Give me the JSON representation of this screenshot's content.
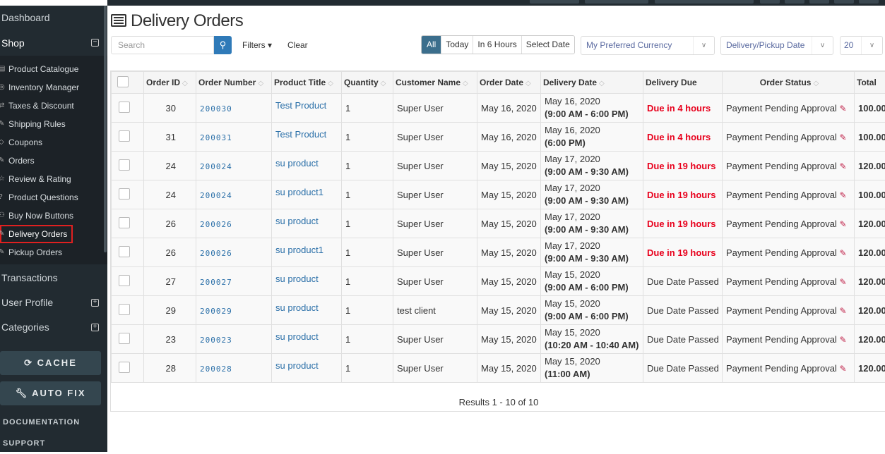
{
  "sidebar": {
    "dashboard": "Dashboard",
    "shop": "Shop",
    "items": [
      {
        "label": "Product Catalogue",
        "icon": "catalogue-icon"
      },
      {
        "label": "Inventory Manager",
        "icon": "inventory-icon"
      },
      {
        "label": "Taxes & Discount",
        "icon": "exchange-icon"
      },
      {
        "label": "Shipping Rules",
        "icon": "wrench-icon"
      },
      {
        "label": "Coupons",
        "icon": "tag-icon"
      },
      {
        "label": "Orders",
        "icon": "pencil-icon"
      },
      {
        "label": "Review & Rating",
        "icon": "star-icon"
      },
      {
        "label": "Product Questions",
        "icon": "question-icon"
      },
      {
        "label": "Buy Now Buttons",
        "icon": "cart-icon"
      },
      {
        "label": "Delivery Orders",
        "icon": "pencil-icon",
        "active": true
      },
      {
        "label": "Pickup Orders",
        "icon": "pencil-icon"
      }
    ],
    "transactions": "Transactions",
    "user_profile": "User Profile",
    "categories": "Categories",
    "cache": "CACHE",
    "auto_fix": "AUTO FIX",
    "documentation": "DOCUMENTATION",
    "support": "SUPPORT"
  },
  "page": {
    "title": "Delivery Orders"
  },
  "toolbar": {
    "search_placeholder": "Search",
    "filters": "Filters ▾",
    "clear": "Clear",
    "segments": [
      "All",
      "Today",
      "In 6 Hours",
      "Select Date"
    ],
    "active_segment": "All",
    "currency": "My Preferred Currency",
    "date_type": "Delivery/Pickup Date",
    "page_size": "20"
  },
  "table": {
    "headers": [
      "Order ID",
      "Order Number",
      "Product Title",
      "Quantity",
      "Customer Name",
      "Order Date",
      "Delivery Date",
      "Delivery Due",
      "Order Status",
      "Total"
    ],
    "rows": [
      {
        "id": "30",
        "num": "200030",
        "product": "Test Product",
        "qty": "1",
        "customer": "Super User",
        "order_date": "May 16, 2020",
        "delivery_date": "May 16, 2020",
        "delivery_time": "(9:00 AM - 6:00 PM)",
        "due": "Due in 4 hours",
        "overdue": false,
        "status": "Payment Pending Approval",
        "total": "100.00"
      },
      {
        "id": "31",
        "num": "200031",
        "product": "Test Product",
        "qty": "1",
        "customer": "Super User",
        "order_date": "May 16, 2020",
        "delivery_date": "May 16, 2020",
        "delivery_time": "(6:00 PM)",
        "due": "Due in 4 hours",
        "overdue": false,
        "status": "Payment Pending Approval",
        "total": "100.00"
      },
      {
        "id": "24",
        "num": "200024",
        "product": "su product",
        "qty": "1",
        "customer": "Super User",
        "order_date": "May 15, 2020",
        "delivery_date": "May 17, 2020",
        "delivery_time": "(9:00 AM - 9:30 AM)",
        "due": "Due in 19 hours",
        "overdue": false,
        "status": "Payment Pending Approval",
        "total": "120.00"
      },
      {
        "id": "24",
        "num": "200024",
        "product": "su product1",
        "qty": "1",
        "customer": "Super User",
        "order_date": "May 15, 2020",
        "delivery_date": "May 17, 2020",
        "delivery_time": "(9:00 AM - 9:30 AM)",
        "due": "Due in 19 hours",
        "overdue": false,
        "status": "Payment Pending Approval",
        "total": "100.00"
      },
      {
        "id": "26",
        "num": "200026",
        "product": "su product",
        "qty": "1",
        "customer": "Super User",
        "order_date": "May 15, 2020",
        "delivery_date": "May 17, 2020",
        "delivery_time": "(9:00 AM - 9:30 AM)",
        "due": "Due in 19 hours",
        "overdue": false,
        "status": "Payment Pending Approval",
        "total": "120.00"
      },
      {
        "id": "26",
        "num": "200026",
        "product": "su product1",
        "qty": "1",
        "customer": "Super User",
        "order_date": "May 15, 2020",
        "delivery_date": "May 17, 2020",
        "delivery_time": "(9:00 AM - 9:30 AM)",
        "due": "Due in 19 hours",
        "overdue": false,
        "status": "Payment Pending Approval",
        "total": "120.00"
      },
      {
        "id": "27",
        "num": "200027",
        "product": "su product",
        "qty": "1",
        "customer": "Super User",
        "order_date": "May 15, 2020",
        "delivery_date": "May 15, 2020",
        "delivery_time": "(9:00 AM - 6:00 PM)",
        "due": "Due Date Passed",
        "overdue": true,
        "status": "Payment Pending Approval",
        "total": "120.00"
      },
      {
        "id": "29",
        "num": "200029",
        "product": "su product",
        "qty": "1",
        "customer": "test client",
        "order_date": "May 15, 2020",
        "delivery_date": "May 15, 2020",
        "delivery_time": "(9:00 AM - 6:00 PM)",
        "due": "Due Date Passed",
        "overdue": true,
        "status": "Payment Pending Approval",
        "total": "120.00"
      },
      {
        "id": "23",
        "num": "200023",
        "product": "su product",
        "qty": "1",
        "customer": "Super User",
        "order_date": "May 15, 2020",
        "delivery_date": "May 15, 2020",
        "delivery_time": "(10:20 AM - 10:40 AM)",
        "due": "Due Date Passed",
        "overdue": true,
        "status": "Payment Pending Approval",
        "total": "120.00"
      },
      {
        "id": "28",
        "num": "200028",
        "product": "su product",
        "qty": "1",
        "customer": "Super User",
        "order_date": "May 15, 2020",
        "delivery_date": "May 15, 2020",
        "delivery_time": "(11:00 AM)",
        "due": "Due Date Passed",
        "overdue": true,
        "status": "Payment Pending Approval",
        "total": "120.00"
      }
    ],
    "results": "Results 1 - 10 of 10"
  },
  "colors": {
    "sidebar": "#222b31",
    "accent": "#2f7ab8",
    "due": "#e8001c",
    "active_outline": "#e02020"
  }
}
